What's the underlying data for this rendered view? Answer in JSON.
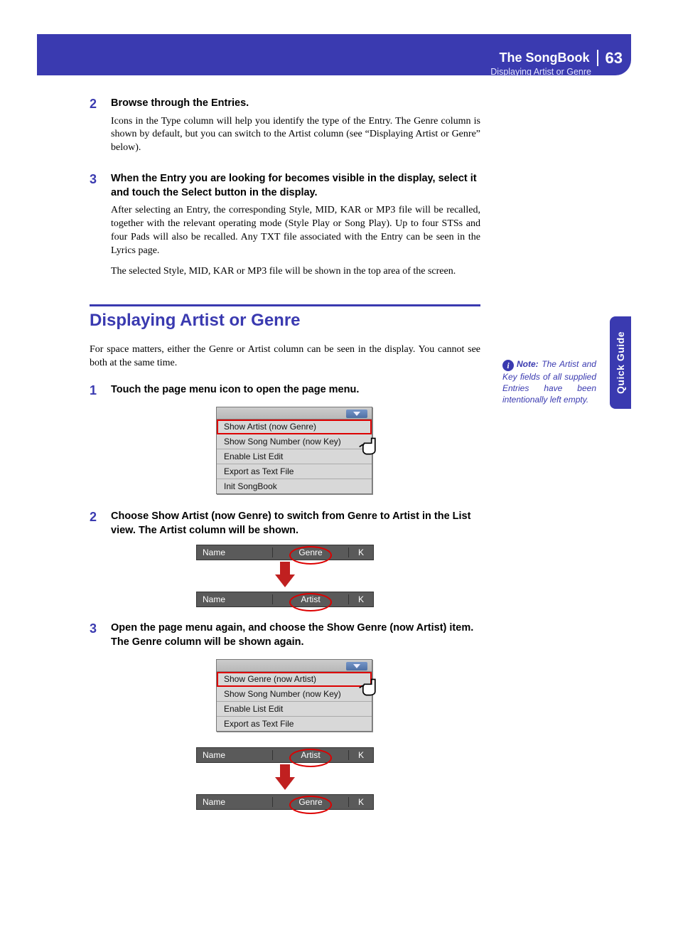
{
  "header": {
    "title": "The SongBook",
    "page_number": "63",
    "subtitle": "Displaying Artist or Genre"
  },
  "side_tab": "Quick Guide",
  "note": {
    "label": "Note:",
    "text": "The Artist and Key fields of all supplied Entries have been intentionally left empty."
  },
  "upper_steps": [
    {
      "num": "2",
      "title": "Browse through the Entries.",
      "paragraphs": [
        "Icons in the Type column will help you identify the type of the Entry. The Genre column is shown by default, but you can switch to the Artist column (see “Displaying Artist or Genre” below)."
      ]
    },
    {
      "num": "3",
      "title": "When the Entry you are looking for becomes visible in the display, select it and touch the Select button in the display.",
      "paragraphs": [
        "After selecting an Entry, the corresponding Style, MID, KAR or MP3 file will be recalled, together with the relevant operating mode (Style Play or Song Play). Up to four STSs and four Pads will also be recalled. Any TXT file associated with the Entry can be seen in the Lyrics page.",
        "The selected Style, MID, KAR or MP3 file will be shown in the top area of the screen."
      ]
    }
  ],
  "section_title": "Displaying Artist or Genre",
  "intro": "For space matters, either the Genre or Artist column can be seen in the display. You cannot see both at the same time.",
  "steps": [
    {
      "num": "1",
      "title": "Touch the page menu icon to open the page menu."
    },
    {
      "num": "2",
      "title": "Choose Show Artist (now Genre) to switch from Genre to Artist in the List view. The Artist column will be shown."
    },
    {
      "num": "3",
      "title": "Open the page menu again, and choose the Show Genre (now Artist) item. The Genre column will be shown again."
    }
  ],
  "menu1": [
    "Show Artist (now Genre)",
    "Show Song Number (now Key)",
    "Enable List Edit",
    "Export as Text File",
    "Init SongBook"
  ],
  "menu2": [
    "Show Genre (now Artist)",
    "Show Song Number (now Key)",
    "Enable List Edit",
    "Export as Text File"
  ],
  "columns": {
    "name": "Name",
    "genre": "Genre",
    "artist": "Artist",
    "k": "K"
  }
}
